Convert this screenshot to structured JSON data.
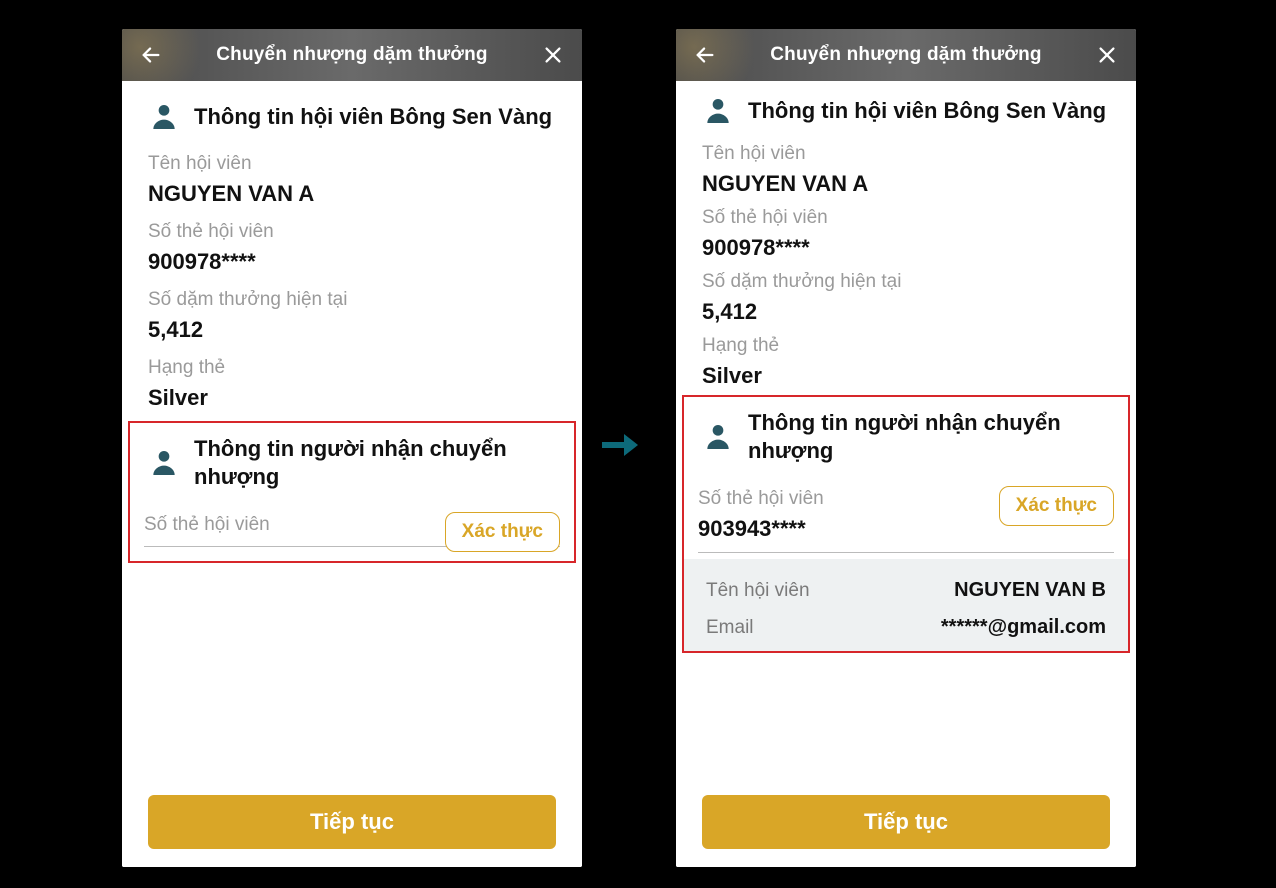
{
  "header": {
    "title": "Chuyển nhượng dặm thưởng"
  },
  "member": {
    "section_title": "Thông tin hội viên Bông Sen Vàng",
    "name_label": "Tên hội viên",
    "name_value": "NGUYEN VAN A",
    "card_label": "Số thẻ hội viên",
    "card_value": "900978****",
    "miles_label": "Số dặm thưởng hiện tại",
    "miles_value": "5,412",
    "tier_label": "Hạng thẻ",
    "tier_value": "Silver"
  },
  "recipient": {
    "section_title": "Thông tin người nhận chuyển nhượng",
    "card_label": "Số thẻ hội viên",
    "card_value": "903943****",
    "verify_btn": "Xác thực",
    "name_label": "Tên hội viên",
    "name_value": "NGUYEN VAN B",
    "email_label": "Email",
    "email_value": "******@gmail.com"
  },
  "actions": {
    "continue": "Tiếp tục"
  }
}
